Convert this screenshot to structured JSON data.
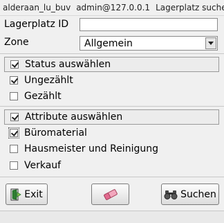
{
  "titlebar": {
    "segments": [
      "alderaan_lu_buv",
      "admin@127.0.0.1",
      "Lagerplatz suchen"
    ]
  },
  "form": {
    "lagerplatz_label": "Lagerplatz ID",
    "lagerplatz_value": "",
    "zone_label": "Zone",
    "zone_selected": "Allgemein"
  },
  "status_group": {
    "header_label": "Status auswählen",
    "header_checked": true,
    "items": [
      {
        "label": "Ungezählt",
        "checked": true
      },
      {
        "label": "Gezählt",
        "checked": false
      }
    ]
  },
  "attribute_group": {
    "header_label": "Attribute auswählen",
    "header_checked": true,
    "items": [
      {
        "label": "Büromaterial",
        "checked": true
      },
      {
        "label": "Hausmeister und Reinigung",
        "checked": false
      },
      {
        "label": "Verkauf",
        "checked": false
      }
    ]
  },
  "buttons": {
    "exit_label": "Exit",
    "clear_label": "",
    "search_label": "Suchen"
  },
  "icons": {
    "exit": "exit-door-icon",
    "clear": "eraser-icon",
    "search": "binoculars-icon",
    "dropdown": "chevron-down-icon",
    "check": "checkmark-icon"
  },
  "colors": {
    "background": "#f0f0f0",
    "input_bg": "#ffffff",
    "border": "#8a8a8a",
    "exit_icon": "#2e7d32",
    "eraser_icon": "#e26a8f"
  }
}
